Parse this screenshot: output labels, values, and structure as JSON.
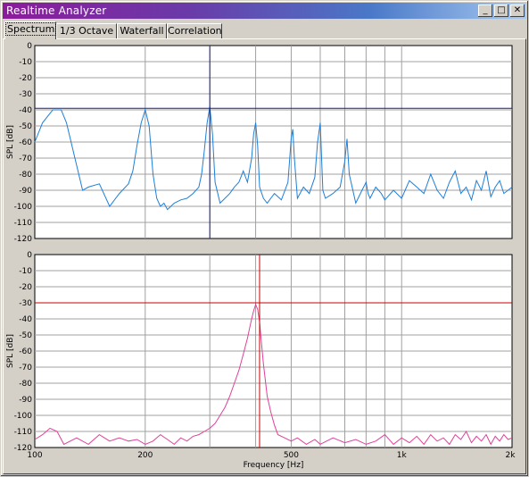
{
  "window": {
    "title": "Realtime Analyzer",
    "buttons": {
      "minimize": "_",
      "maximize": "□",
      "close": "✕"
    }
  },
  "tabs": [
    "Spectrum",
    "1/3 Octave",
    "Waterfall",
    "Correlation"
  ],
  "active_tab": "Spectrum",
  "chart_data": [
    {
      "type": "line",
      "ylabel": "SPL [dB]",
      "xlabel": "",
      "xscale": "log",
      "xlim": [
        100,
        2000
      ],
      "ylim": [
        -120,
        0
      ],
      "yticks": [
        0,
        -10,
        -20,
        -30,
        -40,
        -50,
        -60,
        -70,
        -80,
        -90,
        -100,
        -110,
        -120
      ],
      "cursor": {
        "x": 300,
        "y": -39,
        "color": "#1a1a8c"
      },
      "series": [
        {
          "color": "#1e7fd8",
          "x": [
            100,
            105,
            112,
            118,
            122,
            128,
            135,
            140,
            150,
            160,
            170,
            180,
            185,
            190,
            195,
            200,
            205,
            210,
            215,
            220,
            225,
            230,
            240,
            250,
            260,
            270,
            280,
            285,
            290,
            295,
            300,
            305,
            310,
            320,
            330,
            340,
            350,
            360,
            370,
            380,
            390,
            395,
            400,
            405,
            410,
            420,
            430,
            450,
            470,
            490,
            500,
            505,
            510,
            520,
            540,
            560,
            580,
            590,
            600,
            605,
            610,
            620,
            650,
            680,
            700,
            710,
            720,
            750,
            780,
            800,
            810,
            820,
            850,
            880,
            900,
            950,
            1000,
            1050,
            1100,
            1150,
            1200,
            1250,
            1300,
            1350,
            1400,
            1450,
            1500,
            1550,
            1600,
            1650,
            1700,
            1750,
            1800,
            1850,
            1900,
            1950,
            2000
          ],
          "y": [
            -60,
            -48,
            -40,
            -40,
            -48,
            -68,
            -90,
            -88,
            -86,
            -100,
            -92,
            -86,
            -78,
            -62,
            -48,
            -40,
            -50,
            -80,
            -95,
            -100,
            -98,
            -102,
            -98,
            -96,
            -95,
            -92,
            -88,
            -80,
            -65,
            -48,
            -38,
            -55,
            -85,
            -98,
            -95,
            -92,
            -88,
            -85,
            -78,
            -85,
            -70,
            -55,
            -48,
            -62,
            -88,
            -95,
            -98,
            -92,
            -96,
            -85,
            -58,
            -52,
            -70,
            -95,
            -88,
            -92,
            -82,
            -60,
            -48,
            -70,
            -90,
            -95,
            -92,
            -88,
            -72,
            -58,
            -80,
            -98,
            -90,
            -85,
            -92,
            -95,
            -88,
            -92,
            -96,
            -90,
            -95,
            -84,
            -88,
            -92,
            -80,
            -90,
            -95,
            -85,
            -78,
            -92,
            -88,
            -96,
            -84,
            -90,
            -78,
            -94,
            -88,
            -84,
            -92,
            -90,
            -88
          ]
        }
      ]
    },
    {
      "type": "line",
      "ylabel": "SPL [dB]",
      "xlabel": "Frequency [Hz]",
      "xscale": "log",
      "xlim": [
        100,
        2000
      ],
      "ylim": [
        -120,
        0
      ],
      "xticks": [
        "100",
        "200",
        "500",
        "1k",
        "2k"
      ],
      "yticks": [
        0,
        -10,
        -20,
        -30,
        -40,
        -50,
        -60,
        -70,
        -80,
        -90,
        -100,
        -110,
        -120
      ],
      "cursor": {
        "x": 410,
        "y": -30,
        "color": "#cc0000"
      },
      "series": [
        {
          "color": "#e0409a",
          "x": [
            100,
            105,
            110,
            115,
            120,
            130,
            140,
            150,
            160,
            170,
            180,
            190,
            200,
            210,
            220,
            230,
            240,
            250,
            260,
            270,
            280,
            290,
            300,
            310,
            320,
            330,
            340,
            350,
            360,
            370,
            380,
            385,
            390,
            395,
            400,
            405,
            410,
            415,
            420,
            425,
            430,
            440,
            450,
            460,
            480,
            500,
            520,
            550,
            580,
            600,
            650,
            700,
            750,
            800,
            850,
            900,
            950,
            1000,
            1050,
            1100,
            1150,
            1200,
            1250,
            1300,
            1350,
            1400,
            1450,
            1500,
            1550,
            1600,
            1650,
            1700,
            1750,
            1800,
            1850,
            1900,
            1950,
            2000
          ],
          "y": [
            -115,
            -112,
            -108,
            -110,
            -118,
            -114,
            -118,
            -112,
            -116,
            -114,
            -116,
            -115,
            -118,
            -116,
            -112,
            -115,
            -118,
            -114,
            -116,
            -113,
            -112,
            -110,
            -108,
            -105,
            -100,
            -95,
            -88,
            -80,
            -72,
            -62,
            -52,
            -46,
            -40,
            -35,
            -31,
            -34,
            -42,
            -55,
            -68,
            -78,
            -88,
            -98,
            -106,
            -112,
            -114,
            -116,
            -114,
            -118,
            -115,
            -118,
            -114,
            -117,
            -115,
            -118,
            -116,
            -112,
            -118,
            -114,
            -117,
            -113,
            -118,
            -112,
            -116,
            -114,
            -118,
            -112,
            -115,
            -110,
            -117,
            -113,
            -116,
            -112,
            -118,
            -113,
            -116,
            -112,
            -115,
            -114
          ]
        }
      ]
    }
  ]
}
